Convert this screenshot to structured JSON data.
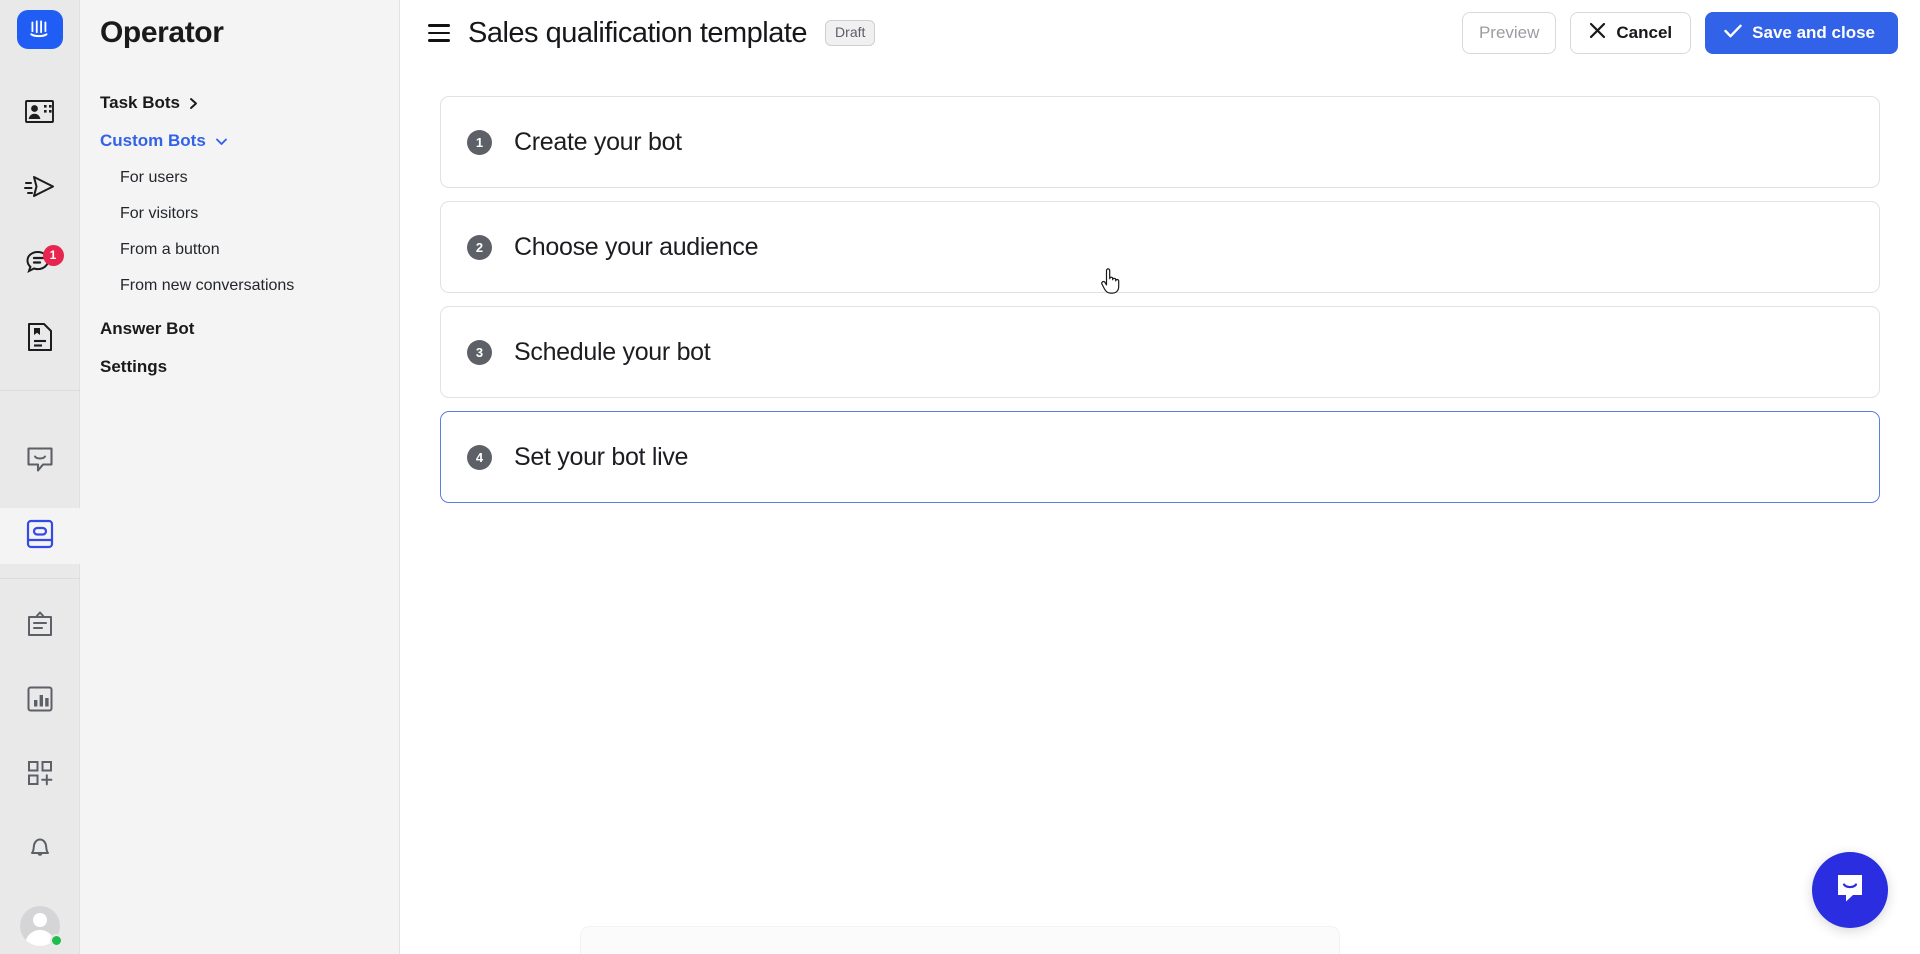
{
  "rail": {
    "logo": {
      "name": "intercom-logo",
      "color": "#1f5df5"
    },
    "items": [
      {
        "icon": "contacts-icon",
        "active": false,
        "badge": null
      },
      {
        "icon": "outbound-send-icon",
        "active": false,
        "badge": null
      },
      {
        "icon": "conversations-icon",
        "active": false,
        "badge": "1"
      },
      {
        "icon": "articles-icon",
        "active": false,
        "badge": null
      },
      {
        "icon": "messenger-chat-icon",
        "active": false,
        "badge": null
      },
      {
        "icon": "operator-bot-icon",
        "active": true,
        "badge": null
      },
      {
        "icon": "clipboard-icon",
        "active": false,
        "badge": null
      },
      {
        "icon": "reports-bar-chart-icon",
        "active": false,
        "badge": null
      },
      {
        "icon": "apps-grid-add-icon",
        "active": false,
        "badge": null
      },
      {
        "icon": "notifications-bell-icon",
        "active": false,
        "badge": null
      }
    ],
    "avatar": {
      "name": "user-avatar",
      "status": "online",
      "status_color": "#1fbe4a"
    }
  },
  "sidebar": {
    "title": "Operator",
    "items": [
      {
        "label": "Task Bots",
        "trailing_icon": "chevron-right-icon",
        "accent": false,
        "sub": false
      },
      {
        "label": "Custom Bots",
        "trailing_icon": "chevron-down-icon",
        "accent": true,
        "sub": false
      },
      {
        "label": "For users",
        "trailing_icon": null,
        "accent": false,
        "sub": true
      },
      {
        "label": "For visitors",
        "trailing_icon": null,
        "accent": false,
        "sub": true
      },
      {
        "label": "From a button",
        "trailing_icon": null,
        "accent": false,
        "sub": true
      },
      {
        "label": "From new conversations",
        "trailing_icon": null,
        "accent": false,
        "sub": true
      },
      {
        "label": "Answer Bot",
        "trailing_icon": null,
        "accent": false,
        "sub": false
      },
      {
        "label": "Settings",
        "trailing_icon": null,
        "accent": false,
        "sub": false
      }
    ],
    "accent_color": "#3262e8"
  },
  "topbar": {
    "menu_icon": "hamburger-menu-icon",
    "title": "Sales qualification template",
    "status_badge": "Draft",
    "preview_label": "Preview",
    "cancel_label": "Cancel",
    "cancel_icon": "close-x-icon",
    "save_label": "Save and close",
    "save_icon": "check-icon",
    "primary_color": "#3262e8"
  },
  "steps": [
    {
      "number": "1",
      "label": "Create your bot",
      "selected": false
    },
    {
      "number": "2",
      "label": "Choose your audience",
      "selected": false
    },
    {
      "number": "3",
      "label": "Schedule your bot",
      "selected": false
    },
    {
      "number": "4",
      "label": "Set your bot live",
      "selected": true
    }
  ],
  "launcher": {
    "icon": "messenger-launcher-icon",
    "color": "#2a2ee0"
  }
}
